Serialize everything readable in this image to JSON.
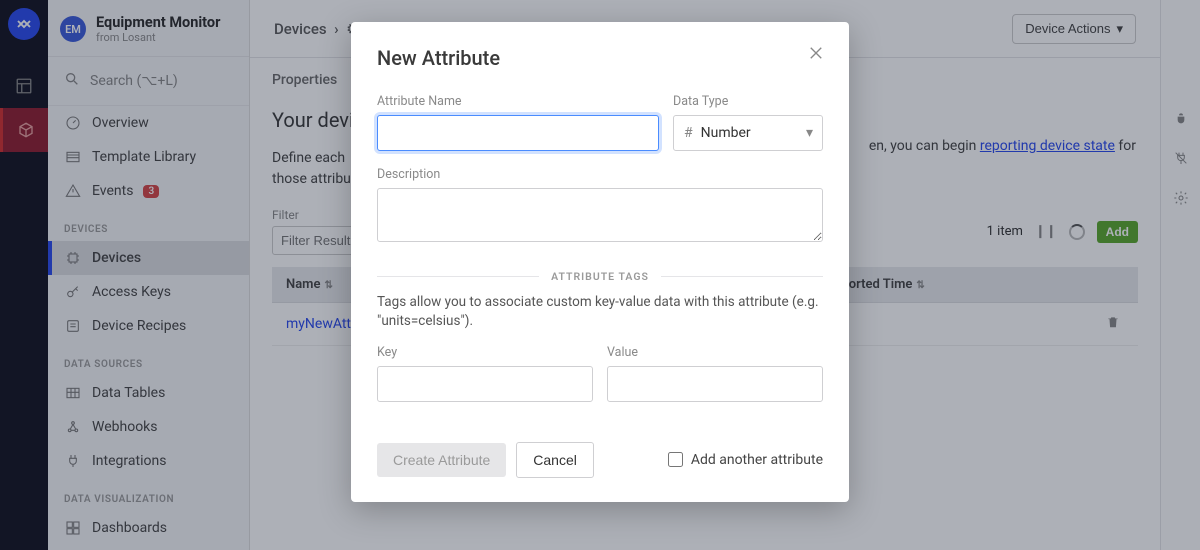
{
  "app": {
    "badge": "EM",
    "name": "Equipment Monitor",
    "from": "from Losant"
  },
  "search": {
    "placeholder": "Search (⌥+L)"
  },
  "nav": {
    "top": [
      {
        "label": "Overview"
      },
      {
        "label": "Template Library"
      },
      {
        "label": "Events",
        "badge": "3"
      }
    ],
    "devices_label": "DEVICES",
    "devices": [
      {
        "label": "Devices"
      },
      {
        "label": "Access Keys"
      },
      {
        "label": "Device Recipes"
      }
    ],
    "data_sources_label": "DATA SOURCES",
    "data_sources": [
      {
        "label": "Data Tables"
      },
      {
        "label": "Webhooks"
      },
      {
        "label": "Integrations"
      }
    ],
    "viz_label": "DATA VISUALIZATION",
    "viz": [
      {
        "label": "Dashboards"
      }
    ]
  },
  "breadcrumb": {
    "root": "Devices",
    "sep": "›"
  },
  "device_actions": "Device Actions",
  "tab": "Properties",
  "main": {
    "heading": "Your devi",
    "para_a": "Define each",
    "link": "reporting device state",
    "para_b_pre": "en, you can begin ",
    "para_b_post": " for",
    "para_c": "those attribu"
  },
  "filter": {
    "label": "Filter",
    "placeholder": "Filter Result"
  },
  "listbar": {
    "count": "1 item",
    "pause": "❙❙",
    "add": "Add"
  },
  "table": {
    "col_name": "Name",
    "col_last": "Last Reported Time",
    "row0_name": "myNewAttr"
  },
  "modal": {
    "title": "New Attribute",
    "attr_name_label": "Attribute Name",
    "data_type_label": "Data Type",
    "data_type_value": "Number",
    "desc_label": "Description",
    "tags_header": "ATTRIBUTE TAGS",
    "tags_help": "Tags allow you to associate custom key-value data with this attribute (e.g. \"units=celsius\").",
    "key_label": "Key",
    "value_label": "Value",
    "create": "Create Attribute",
    "cancel": "Cancel",
    "add_another": "Add another attribute"
  }
}
